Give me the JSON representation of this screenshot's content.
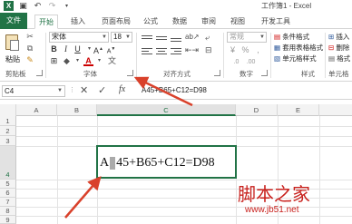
{
  "app": {
    "title": "工作簿1 - Excel",
    "accent": "#217346"
  },
  "qat": {
    "save_icon": "save-icon",
    "undo_icon": "undo-icon",
    "redo_icon": "redo-icon"
  },
  "tabs": {
    "file": "文件",
    "home": "开始",
    "insert": "插入",
    "page_layout": "页面布局",
    "formulas": "公式",
    "data": "数据",
    "review": "审阅",
    "view": "视图",
    "developer": "开发工具"
  },
  "ribbon": {
    "paste_label": "粘贴",
    "clipboard_group": "剪贴板",
    "font_name": "宋体",
    "font_size": "18",
    "font_group": "字体",
    "alignment_group": "对齐方式",
    "number_group": "数字",
    "number_format": "常规",
    "percent_symbol": "%",
    "styles_group": "样式",
    "cells_group": "单元格",
    "conditional_format": "条件格式",
    "format_as_table": "套用表格格式",
    "cell_styles": "单元格样式",
    "insert_cells": "插入",
    "delete_cells": "删除",
    "format_cells": "格式"
  },
  "formula_bar": {
    "name_box": "C4",
    "fx_label": "fx",
    "formula": "A45+B65+C12=D98"
  },
  "sheet": {
    "columns": [
      "A",
      "B",
      "C",
      "D",
      "E"
    ],
    "rows": [
      "1",
      "2",
      "3",
      "4",
      "5",
      "6",
      "7",
      "8",
      "9"
    ],
    "active_cell": "C4",
    "cell_c4_part1": "A",
    "cell_c4_part2": "45+B65+C12=D98"
  },
  "watermark": {
    "cn": "脚本之家",
    "url": "www.jb51.net",
    "color": "#c8201c"
  },
  "annotation_color": "#d9412b"
}
